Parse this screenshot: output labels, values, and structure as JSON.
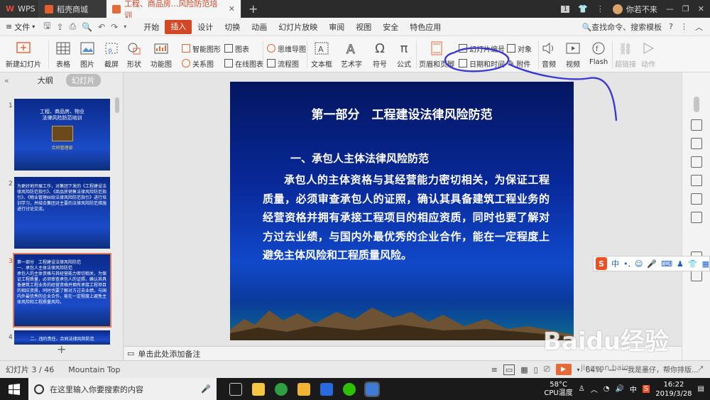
{
  "tabs": [
    {
      "label": "WPS"
    },
    {
      "label": "稻壳商城"
    },
    {
      "label": "工程、商品房...风险防范培训"
    }
  ],
  "window": {
    "page_badge": "1",
    "user": "你若不来"
  },
  "menu": {
    "file": "文件",
    "items": [
      "开始",
      "插入",
      "设计",
      "切换",
      "动画",
      "幻灯片放映",
      "审阅",
      "视图",
      "安全",
      "特色应用"
    ],
    "active": "插入",
    "search": "查找命令、搜索模板"
  },
  "ribbon": {
    "new_slide": "新建幻灯片",
    "table": "表格",
    "image": "图片",
    "screenshot": "截屏",
    "shape": "形状",
    "function_chart": "功能图",
    "smartart": "智能图形",
    "chart": "图表",
    "relation": "关系图",
    "online_chart": "在线图表",
    "mindmap": "思维导图",
    "flowchart": "流程图",
    "textbox": "文本框",
    "wordart": "艺术字",
    "symbol": "符号",
    "formula": "公式",
    "header_footer": "页眉和页脚",
    "slide_number": "幻灯片编号",
    "object": "对象",
    "date_time": "日期和时间",
    "attachment": "附件",
    "audio": "音频",
    "video": "视频",
    "flash": "Flash",
    "hyperlink": "超链接",
    "action": "动作"
  },
  "panel": {
    "outline_tab": "大纲",
    "slides_tab": "幻灯片"
  },
  "thumbnails": [
    {
      "num": "1",
      "title": "工程、商品房、物业\n法律风险防范培训",
      "footer": "合同管理部"
    },
    {
      "num": "2",
      "title": "为更好地开展工作，对集团下发的《工程建设法律风险防范指引》、《商品房销售法律风险防范指引》、《物业管理纠纷法律风险防范指引》进行培训学习，并结合集团对主要的法律风险防范措施进行讨论交流。"
    },
    {
      "num": "3",
      "title": "第一部分　工程建设法律风险防范\n一、承包人主体法律风险防范\n承包人的主体资格与其经营能力密切相关，为保证工程质量，必须审查承包人的证照，确认其具备建筑工程业务的经营资格并拥有承接工程项目的相应资质，同时也要了解对方过去业绩，与国内外最优秀的企业合作，能在一定程度上避免主体风险和工程质量风险。"
    },
    {
      "num": "4",
      "title": "二、违约责任、合同法律风险防范"
    }
  ],
  "slide": {
    "title": "第一部分　工程建设法律风险防范",
    "subtitle": "一、承包人主体法律风险防范",
    "body": "承包人的主体资格与其经营能力密切相关，为保证工程质量，必须审查承包人的证照，确认其具备建筑工程业务的经营资格并拥有承接工程项目的相应资质，同时也要了解对方过去业绩，与国内外最优秀的企业合作，能在一定程度上避免主体风险和工程质量风险。"
  },
  "notes_placeholder": "单击此处添加备注",
  "status": {
    "slide_info": "幻灯片 3 / 46",
    "theme": "Mountain Top",
    "zoom": "64%"
  },
  "ime": {
    "mode": "中"
  },
  "taskbar": {
    "search_placeholder": "在这里输入你要搜索的内容",
    "cpu_temp": "58°C",
    "cpu_label": "CPU温度",
    "ime": "中",
    "time": "16:22",
    "date": "2019/3/28"
  },
  "watermark": {
    "logo": "Baidu经验",
    "url": "jingyan.baidu.com",
    "overlay": "我是墨仔，帮你排版..."
  },
  "colors": {
    "accent": "#d24726",
    "slide_bg": "#08299a",
    "annotation": "#3a3ad0"
  }
}
